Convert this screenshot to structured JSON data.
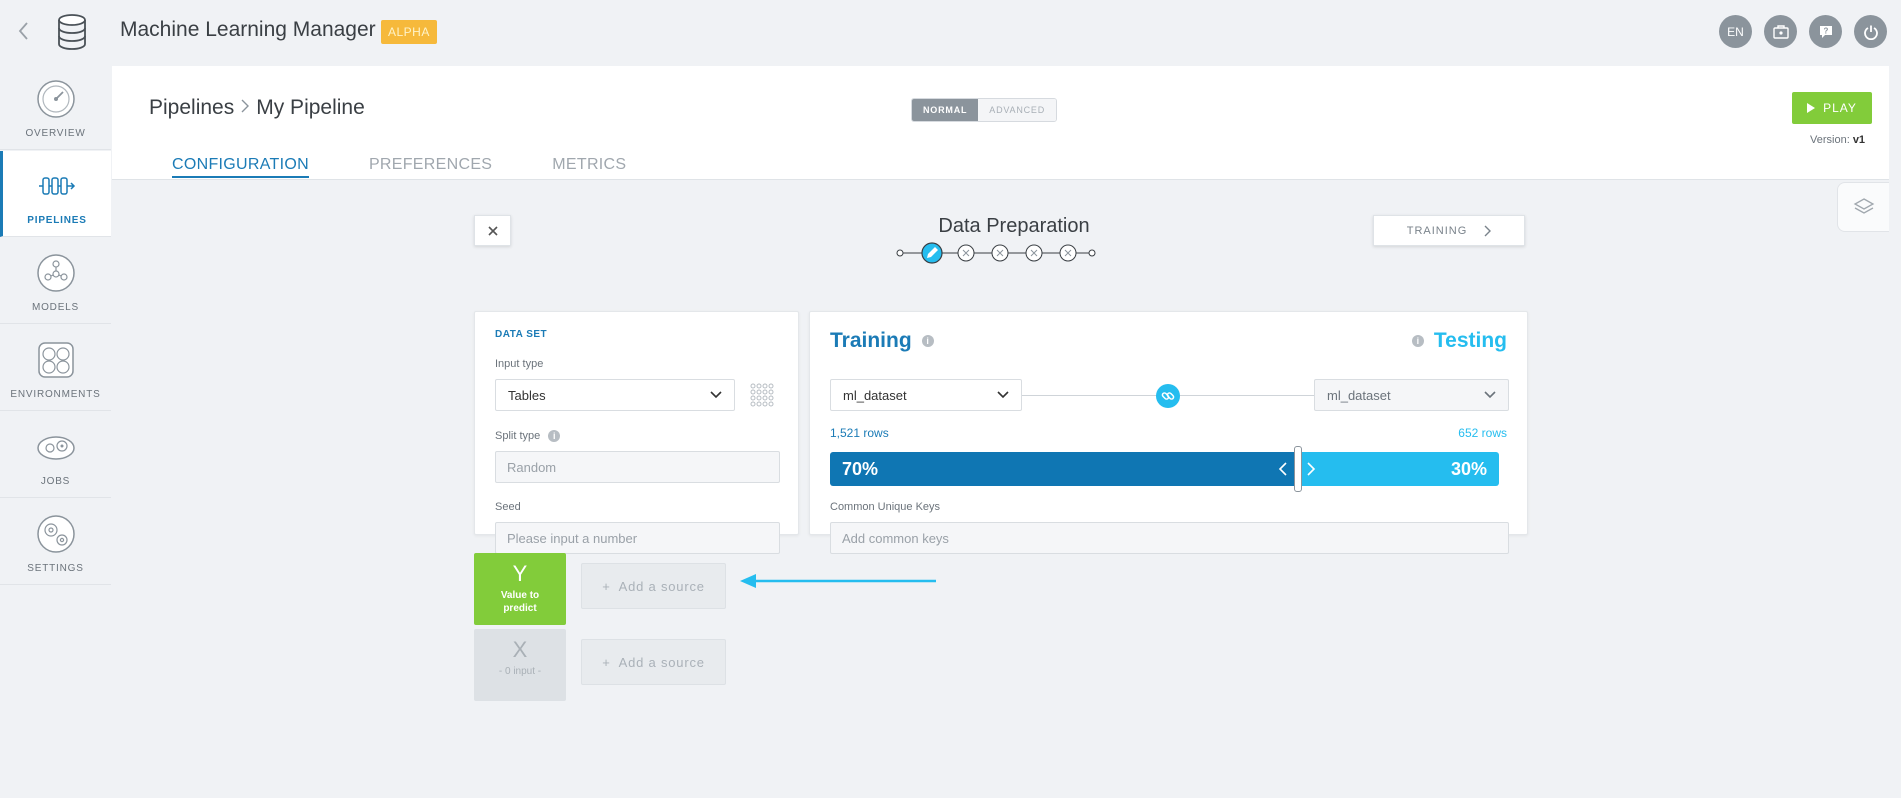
{
  "app": {
    "title": "Machine Learning Manager",
    "badge": "ALPHA",
    "language": "EN"
  },
  "sidebar": {
    "items": [
      {
        "label": "OVERVIEW"
      },
      {
        "label": "PIPELINES"
      },
      {
        "label": "MODELS"
      },
      {
        "label": "ENVIRONMENTS"
      },
      {
        "label": "JOBS"
      },
      {
        "label": "SETTINGS"
      }
    ],
    "active": "PIPELINES"
  },
  "header": {
    "breadcrumb_root": "Pipelines",
    "breadcrumb_current": "My Pipeline",
    "mode_normal": "NORMAL",
    "mode_advanced": "ADVANCED",
    "mode_selected": "NORMAL",
    "play_label": "PLAY",
    "version_label": "Version:",
    "version_value": "v1"
  },
  "tabs": [
    {
      "label": "CONFIGURATION"
    },
    {
      "label": "PREFERENCES"
    },
    {
      "label": "METRICS"
    }
  ],
  "tab_active": "CONFIGURATION",
  "step": {
    "title": "Data Preparation",
    "next_label": "TRAINING",
    "current_step": 1,
    "total_steps": 5
  },
  "dataset": {
    "heading": "DATA SET",
    "input_type_label": "Input type",
    "input_type_value": "Tables",
    "split_type_label": "Split type",
    "split_type_value": "Random",
    "seed_label": "Seed",
    "seed_placeholder": "Please input a number"
  },
  "split": {
    "training_title": "Training",
    "testing_title": "Testing",
    "training_dataset": "ml_dataset",
    "testing_dataset": "ml_dataset",
    "training_rows": "1,521 rows",
    "testing_rows": "652 rows",
    "training_pct": "70%",
    "testing_pct": "30%",
    "training_fraction": 0.7,
    "common_keys_label": "Common Unique Keys",
    "common_keys_placeholder": "Add common keys"
  },
  "sources": {
    "y_letter": "Y",
    "y_sub": "Value to predict",
    "x_letter": "X",
    "x_sub": "- 0 input -",
    "add_source_label": "Add a source"
  },
  "colors": {
    "primary": "#1b7bb6",
    "testing": "#25bdef",
    "play": "#82cc3a",
    "badge": "#f6b93b"
  }
}
